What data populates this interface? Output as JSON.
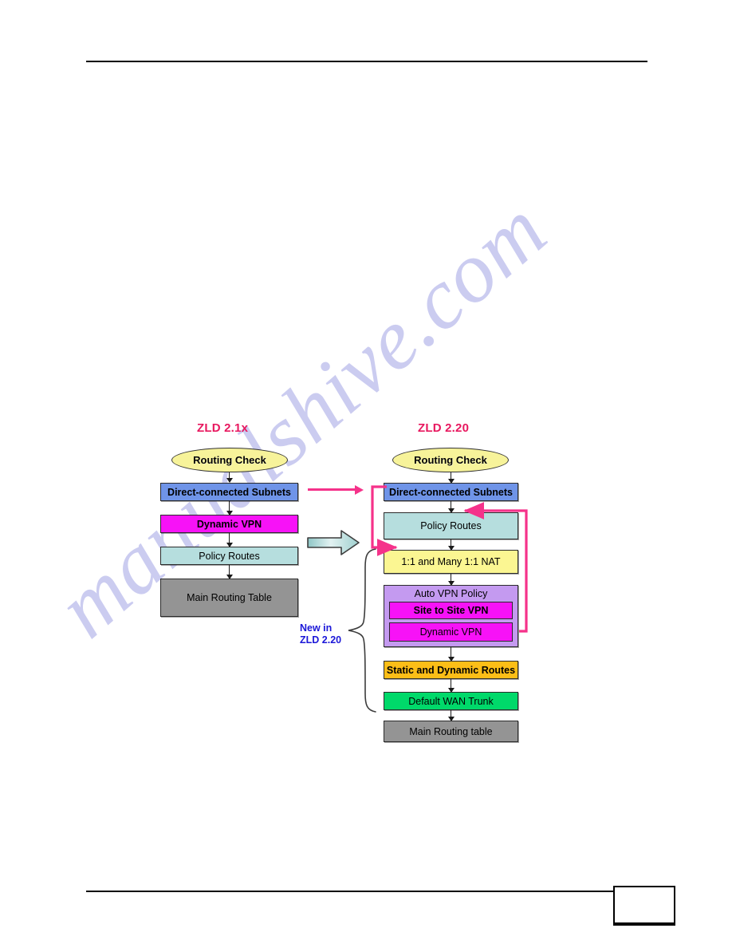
{
  "page": {
    "footer_page_number": "",
    "watermark_text": "manualshive.com"
  },
  "diagram": {
    "left_column": {
      "title": "ZLD 2.1x",
      "nodes": [
        {
          "label": "Routing Check",
          "shape": "ellipse",
          "color": "#f7f39a"
        },
        {
          "label": "Direct-connected Subnets",
          "shape": "box",
          "color": "#6f94e8"
        },
        {
          "label": "Dynamic VPN",
          "shape": "box",
          "color": "#f712f7"
        },
        {
          "label": "Policy Routes",
          "shape": "box",
          "color": "#b6dede"
        },
        {
          "label": "Main Routing Table",
          "shape": "box",
          "color": "#949494"
        }
      ]
    },
    "right_column": {
      "title": "ZLD 2.20",
      "nodes": [
        {
          "label": "Routing Check",
          "shape": "ellipse",
          "color": "#f7f39a"
        },
        {
          "label": "Direct-connected Subnets",
          "shape": "box",
          "color": "#6f94e8"
        },
        {
          "label": "Policy Routes",
          "shape": "box",
          "color": "#b6dede"
        },
        {
          "label": "1:1 and Many 1:1 NAT",
          "shape": "box",
          "color": "#fbf692"
        },
        {
          "label": "Auto VPN Policy",
          "shape": "group",
          "color": "#c49af0"
        },
        {
          "label": "Site to Site VPN",
          "shape": "box",
          "color": "#f712f7"
        },
        {
          "label": "Dynamic VPN",
          "shape": "box",
          "color": "#f712f7"
        },
        {
          "label": "Static and Dynamic Routes",
          "shape": "box",
          "color": "#fcbe17"
        },
        {
          "label": "Default WAN Trunk",
          "shape": "box",
          "color": "#00d96a"
        },
        {
          "label": "Main Routing table",
          "shape": "box",
          "color": "#949494"
        }
      ]
    },
    "annotation": {
      "line1": "New in",
      "line2": "ZLD 2.20",
      "color": "#1b17d8"
    },
    "colors": {
      "title_accent": "#e8185f",
      "loop_arrow": "#f5328a",
      "bridge_arrow": "#f5328a",
      "block_arrow_fill": "#a8d4d4",
      "connector": "#1a1a1a"
    }
  }
}
